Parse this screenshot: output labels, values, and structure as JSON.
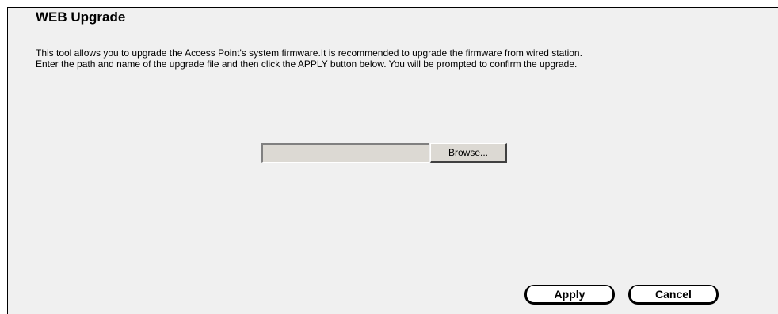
{
  "page": {
    "title": "WEB Upgrade",
    "description_line1": "This tool allows you to upgrade the Access Point's system firmware.It is recommended to upgrade the firmware from wired station.",
    "description_line2": "Enter the path and name of the upgrade file and then click the APPLY button below. You will be prompted to confirm the upgrade."
  },
  "upload": {
    "file_path_value": "",
    "browse_label": "Browse..."
  },
  "actions": {
    "apply_label": "Apply",
    "cancel_label": "Cancel"
  },
  "colors": {
    "panel_background": "#f0f0f0",
    "field_background": "#dcd9d3",
    "button_background": "#ffffff"
  }
}
